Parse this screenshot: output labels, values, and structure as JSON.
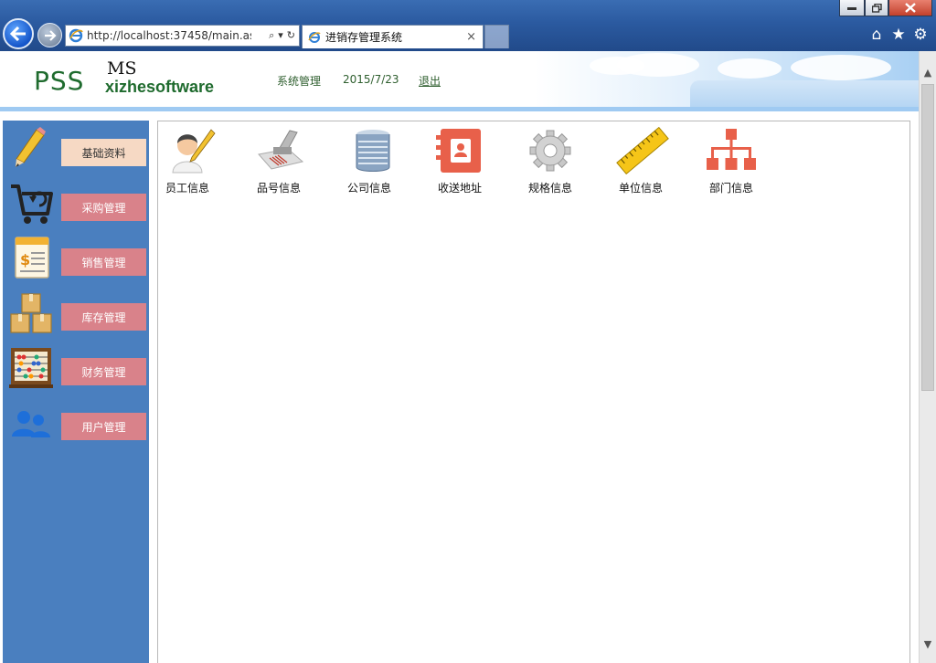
{
  "browser": {
    "address_url": "http://localhost:37458/main.as",
    "tab_title": "进销存管理系统",
    "tab_close": "×",
    "window_controls": [
      "minimize-icon",
      "restore-icon",
      "close-icon"
    ],
    "tools": [
      "home-icon",
      "favorites-star-icon",
      "settings-gear-icon"
    ]
  },
  "header": {
    "logo_pss": "PSS",
    "logo_ms": "MS",
    "logo_brand": "xizhesoftware",
    "system_menu": "系统管理",
    "date": "2015/7/23",
    "logout": "退出"
  },
  "sidebar": {
    "items": [
      {
        "label": "基础资料",
        "icon": "pencil-icon",
        "active": true
      },
      {
        "label": "采购管理",
        "icon": "shopping-cart-icon",
        "active": false
      },
      {
        "label": "销售管理",
        "icon": "invoice-dollar-icon",
        "active": false
      },
      {
        "label": "库存管理",
        "icon": "boxes-icon",
        "active": false
      },
      {
        "label": "财务管理",
        "icon": "abacus-icon",
        "active": false
      },
      {
        "label": "用户管理",
        "icon": "users-icon",
        "active": false
      }
    ]
  },
  "content": {
    "tiles": [
      {
        "label": "员工信息",
        "icon": "employee-icon"
      },
      {
        "label": "品号信息",
        "icon": "barcode-scanner-icon"
      },
      {
        "label": "公司信息",
        "icon": "office-building-icon"
      },
      {
        "label": "收送地址",
        "icon": "address-book-icon"
      },
      {
        "label": "规格信息",
        "icon": "gear-icon"
      },
      {
        "label": "单位信息",
        "icon": "ruler-icon"
      },
      {
        "label": "部门信息",
        "icon": "org-chart-icon"
      }
    ]
  },
  "colors": {
    "sidebar_bg": "#4a7fbf",
    "side_btn": "#d9828a",
    "side_btn_active": "#f6d9c4",
    "brand_green": "#1f6b2e"
  }
}
